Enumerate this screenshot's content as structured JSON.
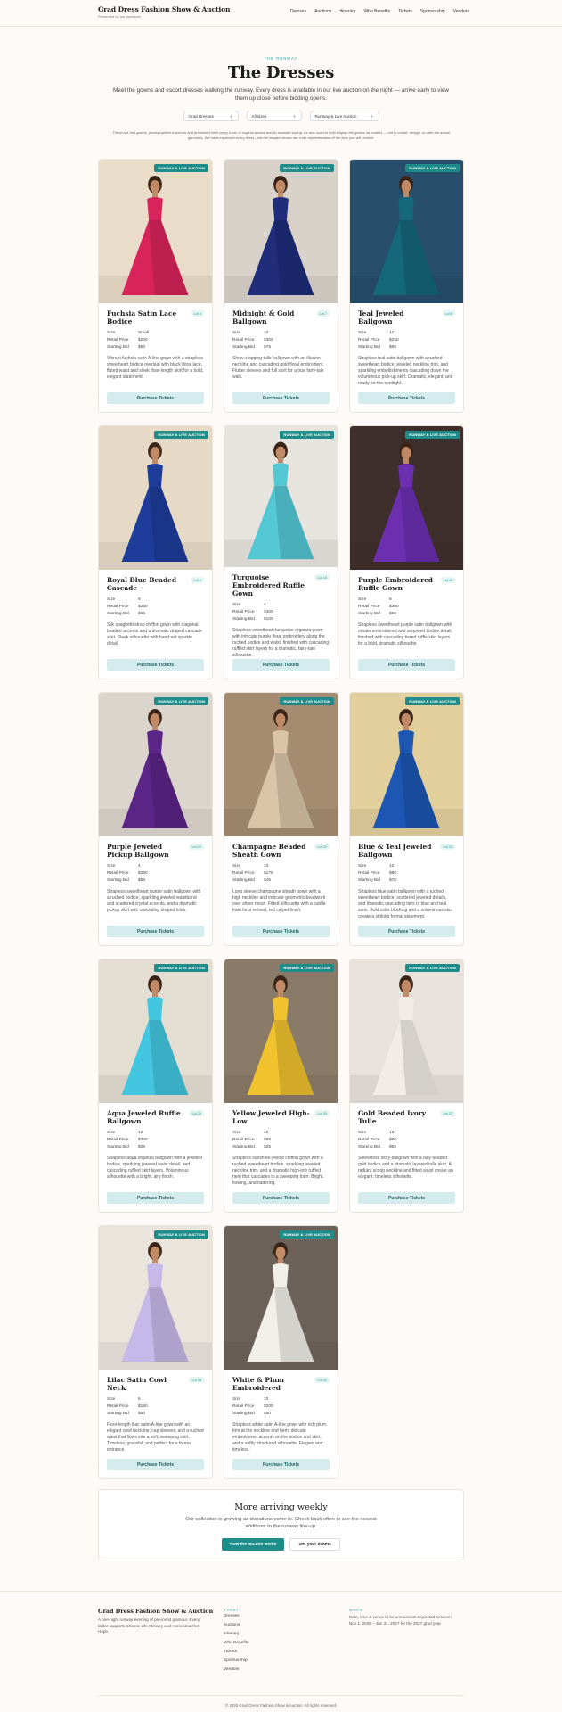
{
  "header": {
    "brand": "Grad Dress Fashion Show & Auction",
    "tagline": "Presented by our sponsors",
    "nav": [
      "Dresses",
      "Auctions",
      "Itinerary",
      "Who Benefits",
      "Tickets",
      "Sponsorship",
      "Vendors"
    ]
  },
  "hero": {
    "eyebrow": "THE RUNWAY",
    "title": "The Dresses",
    "lead": "Meet the gowns and escort dresses walking the runway. Every dress is available in our live auction on the night — arrive early to view them up close before bidding opens.",
    "filters": [
      {
        "label": "Grad Dresses"
      },
      {
        "label": "All sizes"
      },
      {
        "label": "Runway & Live Auction"
      }
    ],
    "note": "These are real gowns, photographed in person and presented here using a mix of original photos and AI-assisted styling. As was used to help display the gowns on models — not to create, design, or alter the actual garments. We have inspected every dress, and the images shown are a fair representation of the item you will receive."
  },
  "card_labels": {
    "badge": "RUNWAY & LIVE AUCTION",
    "size": "Size",
    "retail": "Retail Price",
    "starting": "Starting Bid",
    "cta": "Purchase Tickets"
  },
  "dresses": [
    {
      "name": "Fuchsia Satin Lace Bodice",
      "lot": "Lot 6",
      "size": "Small",
      "retail": "$200",
      "bid": "$50",
      "desc": "Vibrant fuchsia satin A-line gown with a strapless sweetheart bodice overlaid with black floral lace, fluted waist and sleek floor-length skirt for a bold, elegant statement.",
      "color": "#d8245a",
      "bg": "#e9dcc8"
    },
    {
      "name": "Midnight & Gold Ballgown",
      "lot": "Lot 7",
      "size": "10",
      "retail": "$300",
      "bid": "$75",
      "desc": "Show-stopping tulle ballgown with an illusion neckline and cascading gold floral embroidery. Flutter sleeves and full skirt for a true fairy-tale walk.",
      "color": "#1f2d7a",
      "bg": "#d8d2ca"
    },
    {
      "name": "Teal Jeweled Ballgown",
      "lot": "Lot 8",
      "size": "12",
      "retail": "$250",
      "bid": "$65",
      "desc": "Strapless teal satin ballgown with a ruched sweetheart bodice, jeweled neckline trim, and sparkling embellishments cascading down the voluminous pick-up skirt. Dramatic, elegant, and ready for the spotlight.",
      "color": "#15677a",
      "bg": "#274e6b"
    },
    {
      "name": "Royal Blue Beaded Cascade",
      "lot": "Lot 9",
      "size": "8",
      "retail": "$250",
      "bid": "$65",
      "desc": "Silk spaghetti-strap chiffon gown with diagonal beaded accents and a dramatic draped cascade skirt. Sleek silhouette with hand-set sparkle detail.",
      "color": "#1e3c9a",
      "bg": "#e6dac6"
    },
    {
      "name": "Turquoise Embroidered Ruffle Gown",
      "lot": "Lot 10",
      "size": "4",
      "retail": "$400",
      "bid": "$100",
      "desc": "Strapless sweetheart turquoise organza gown with intricate purple floral embroidery along the ruched bodice and waist, finished with cascading ruffled skirt layers for a dramatic, fairy-tale silhouette.",
      "color": "#53c7d4",
      "bg": "#e7e3dd"
    },
    {
      "name": "Purple Embroidered Ruffle Gown",
      "lot": "Lot 11",
      "size": "8",
      "retail": "$300",
      "bid": "$65",
      "desc": "Strapless sweetheart purple satin ballgown with ornate embroidered and sequined bodice detail, finished with cascading tiered ruffle skirt layers for a bold, dramatic silhouette.",
      "color": "#6b2fb0",
      "bg": "#3f2f2c"
    },
    {
      "name": "Purple Jeweled Pickup Ballgown",
      "lot": "Lot 20",
      "size": "4",
      "retail": "$250",
      "bid": "$65",
      "desc": "Strapless sweetheart purple satin ballgown with a ruched bodice, sparkling jeweled waistband and scattered crystal accents, and a dramatic pickup skirt with cascading draped folds.",
      "color": "#5c2588",
      "bg": "#dcd5cd"
    },
    {
      "name": "Champagne Beaded Sheath Gown",
      "lot": "Lot 22",
      "size": "10",
      "retail": "$175",
      "bid": "$45",
      "desc": "Long sleeve champagne sheath gown with a high neckline and intricate geometric beadwork over sheer mesh. Fitted silhouette with a subtle train for a refined, red carpet finish.",
      "color": "#d9c4a8",
      "bg": "#a58c70"
    },
    {
      "name": "Blue & Teal Jeweled Ballgown",
      "lot": "Lot 23",
      "size": "12",
      "retail": "$80",
      "bid": "$70",
      "desc": "Strapless blue satin ballgown with a ruched sweetheart bodice, scattered jeweled details, and dramatic cascading tiers of blue and teal satin. Bold color blocking and a voluminous skirt create a striking formal statement.",
      "color": "#1d56b3",
      "bg": "#e3cf9c"
    },
    {
      "name": "Aqua Jeweled Ruffle Ballgown",
      "lot": "Lot 24",
      "size": "12",
      "retail": "$300",
      "bid": "$25",
      "desc": "Strapless aqua organza ballgown with a jeweled bodice, sparkling jeweled waist detail, and cascading ruffled skirt layers. Voluminous silhouette with a bright, airy finish.",
      "color": "#43c6e0",
      "bg": "#e4ddd2"
    },
    {
      "name": "Yellow Jeweled High-Low",
      "lot": "Lot 25",
      "size": "12",
      "retail": "$85",
      "bid": "$25",
      "desc": "Strapless sunshine-yellow chiffon gown with a ruched sweetheart bodice, sparkling jeweled neckline trim, and a dramatic high-low ruffled hem that cascades to a sweeping train. Bright, flowing, and flattering.",
      "color": "#f0c22e",
      "bg": "#8a7a68"
    },
    {
      "name": "Gold Beaded Ivory Tulle",
      "lot": "Lot 27",
      "size": "12",
      "retail": "$80",
      "bid": "$65",
      "desc": "Sleeveless ivory ballgown with a fully beaded gold bodice and a dramatic layered tulle skirt. A radiant scoop neckline and fitted waist create an elegant, timeless silhouette.",
      "color": "#f1ede6",
      "bg": "#e7e2dc"
    },
    {
      "name": "Lilac Satin Cowl Neck",
      "lot": "Lot 38",
      "size": "6",
      "retail": "$150",
      "bid": "$50",
      "desc": "Floor-length lilac satin A-line gown with an elegant cowl neckline, cap sleeves, and a ruched waist that flows into a soft, sweeping skirt. Timeless, graceful, and perfect for a formal entrance.",
      "color": "#c4b9e8",
      "bg": "#e9e4dc"
    },
    {
      "name": "White & Plum Embroidered",
      "lot": "Lot 40",
      "size": "10",
      "retail": "$200",
      "bid": "$50",
      "desc": "Strapless white satin A-line gown with rich plum trim at the neckline and hem, delicate embroidered accents on the bodice and skirt, and a softly structured silhouette. Elegant and timeless.",
      "color": "#f2efe9",
      "bg": "#6d6259"
    }
  ],
  "more": {
    "title": "More arriving weekly",
    "desc": "Our collection is growing as donations come in. Check back often to see the newest additions to the runway line-up.",
    "primary": "How the auction works",
    "secondary": "Get your tickets"
  },
  "footer": {
    "title": "Grad Dress Fashion Show & Auction",
    "desc": "A one-night runway evening of pre-loved glamour. Every dollar supports Choose Life Ministry and Homestead for Hope.",
    "events_heading": "EVENT",
    "links": [
      "Dresses",
      "Auctions",
      "Itinerary",
      "Who Benefits",
      "Tickets",
      "Sponsorship",
      "Vendors"
    ],
    "when_heading": "WHEN",
    "when_text": "Date, time & venue to be announced. Expected between Nov 1, 2026 – Jan 31, 2027 for the 2027 grad year.",
    "copyright": "© 2026 Grad Dress Fashion Show & Auction. All rights reserved."
  }
}
